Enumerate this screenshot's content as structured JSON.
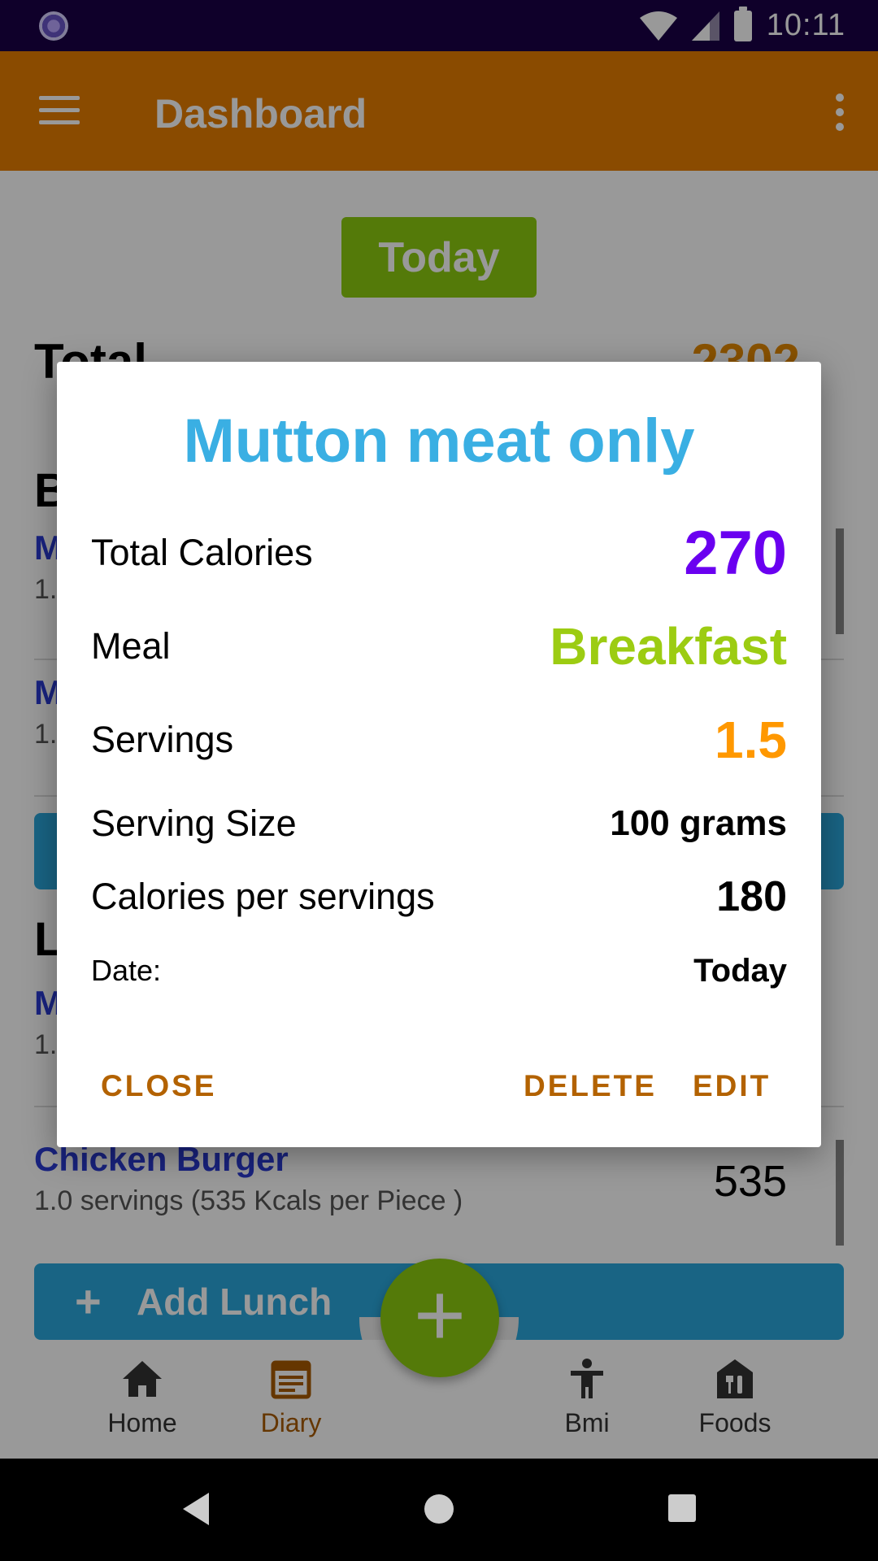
{
  "status_bar": {
    "time": "10:11"
  },
  "app_bar": {
    "title": "Dashboard"
  },
  "content": {
    "today_button": "Today",
    "total_label": "Total",
    "total_value": "2302",
    "breakfast_initial": "B",
    "lunch_initial": "L",
    "entries": [
      {
        "name": "M",
        "sub": "1.",
        "kcal": ""
      },
      {
        "name": "M",
        "sub": "1.",
        "kcal": ""
      },
      {
        "name": "M",
        "sub": "1.",
        "kcal": ""
      },
      {
        "name": "Chicken Burger",
        "sub": "1.0 servings (535 Kcals per Piece )",
        "kcal": "535"
      }
    ],
    "add_lunch": {
      "plus": "+",
      "label": "Add Lunch"
    }
  },
  "bottom_nav": {
    "items": [
      {
        "label": "Home",
        "icon": "home-icon"
      },
      {
        "label": "Diary",
        "icon": "diary-icon",
        "active": true
      },
      {
        "label": "Bmi",
        "icon": "person-icon"
      },
      {
        "label": "Foods",
        "icon": "foods-icon"
      }
    ],
    "fab": "+"
  },
  "dialog": {
    "title": "Mutton meat only",
    "rows": [
      {
        "label": "Total Calories",
        "value": "270",
        "color": "#6a00f0"
      },
      {
        "label": "Meal",
        "value": "Breakfast",
        "color": "#9ccc12"
      },
      {
        "label": "Servings",
        "value": "1.5",
        "color": "#ff9800"
      },
      {
        "label": "Serving Size",
        "value": "100 grams"
      },
      {
        "label": "Calories per servings",
        "value": "180"
      },
      {
        "label": "Date:",
        "value": "Today"
      }
    ],
    "buttons": {
      "close": "CLOSE",
      "delete": "DELETE",
      "edit": "EDIT"
    }
  }
}
